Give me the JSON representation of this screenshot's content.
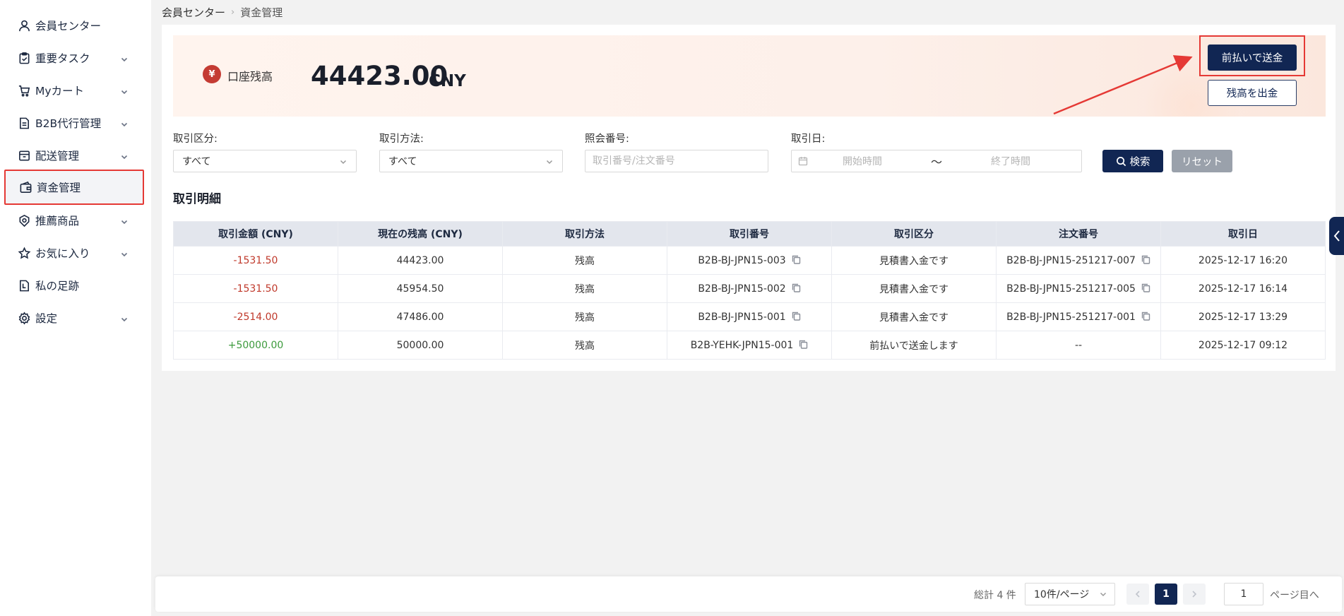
{
  "sidebar": {
    "items": [
      {
        "label": "会員センター",
        "icon": "user-icon",
        "has_children": false
      },
      {
        "label": "重要タスク",
        "icon": "clipboard-check-icon",
        "has_children": true
      },
      {
        "label": "Myカート",
        "icon": "cart-icon",
        "has_children": true
      },
      {
        "label": "B2B代行管理",
        "icon": "document-icon",
        "has_children": true
      },
      {
        "label": "配送管理",
        "icon": "box-icon",
        "has_children": true
      },
      {
        "label": "資金管理",
        "icon": "wallet-icon",
        "has_children": false,
        "active": true
      },
      {
        "label": "推薦商品",
        "icon": "badge-icon",
        "has_children": true
      },
      {
        "label": "お気に入り",
        "icon": "star-icon",
        "has_children": true
      },
      {
        "label": "私の足跡",
        "icon": "footprint-icon",
        "has_children": false
      },
      {
        "label": "設定",
        "icon": "gear-icon",
        "has_children": true
      }
    ]
  },
  "breadcrumb": {
    "root": "会員センター",
    "current": "資金管理"
  },
  "balance": {
    "label": "口座残高",
    "amount": "44423.00",
    "currency": "CNY"
  },
  "actions": {
    "prepay": "前払いで送金",
    "withdraw": "残高を出金"
  },
  "filters": {
    "type": {
      "label": "取引区分:",
      "value": "すべて"
    },
    "method": {
      "label": "取引方法:",
      "value": "すべて"
    },
    "ref": {
      "label": "照会番号:",
      "placeholder": "取引番号/注文番号"
    },
    "date": {
      "label": "取引日:",
      "start_placeholder": "開始時間",
      "separator": "〜",
      "end_placeholder": "終了時間"
    },
    "search": "検索",
    "reset": "リセット"
  },
  "table": {
    "title": "取引明細",
    "headers": [
      "取引金額 (CNY)",
      "現在の残高 (CNY)",
      "取引方法",
      "取引番号",
      "取引区分",
      "注文番号",
      "取引日"
    ],
    "rows": [
      {
        "amount": "-1531.50",
        "amount_type": "neg",
        "balance": "44423.00",
        "method": "残高",
        "tx_no": "B2B-BJ-JPN15-003",
        "category": "見積書入金です",
        "order_no": "B2B-BJ-JPN15-251217-007",
        "date": "2025-12-17 16:20"
      },
      {
        "amount": "-1531.50",
        "amount_type": "neg",
        "balance": "45954.50",
        "method": "残高",
        "tx_no": "B2B-BJ-JPN15-002",
        "category": "見積書入金です",
        "order_no": "B2B-BJ-JPN15-251217-005",
        "date": "2025-12-17 16:14"
      },
      {
        "amount": "-2514.00",
        "amount_type": "neg",
        "balance": "47486.00",
        "method": "残高",
        "tx_no": "B2B-BJ-JPN15-001",
        "category": "見積書入金です",
        "order_no": "B2B-BJ-JPN15-251217-001",
        "date": "2025-12-17 13:29"
      },
      {
        "amount": "+50000.00",
        "amount_type": "pos",
        "balance": "50000.00",
        "method": "残高",
        "tx_no": "B2B-YEHK-JPN15-001",
        "category": "前払いで送金します",
        "order_no": "--",
        "date": "2025-12-17 09:12"
      }
    ]
  },
  "pagination": {
    "total": "総計 4 件",
    "page_size": "10件/ページ",
    "current_page": "1",
    "jump_value": "1",
    "jump_label": "ページ目へ"
  },
  "colors": {
    "primary": "#112653",
    "highlight": "#e53935",
    "negative": "#c0392b",
    "positive": "#3c9a3c"
  }
}
